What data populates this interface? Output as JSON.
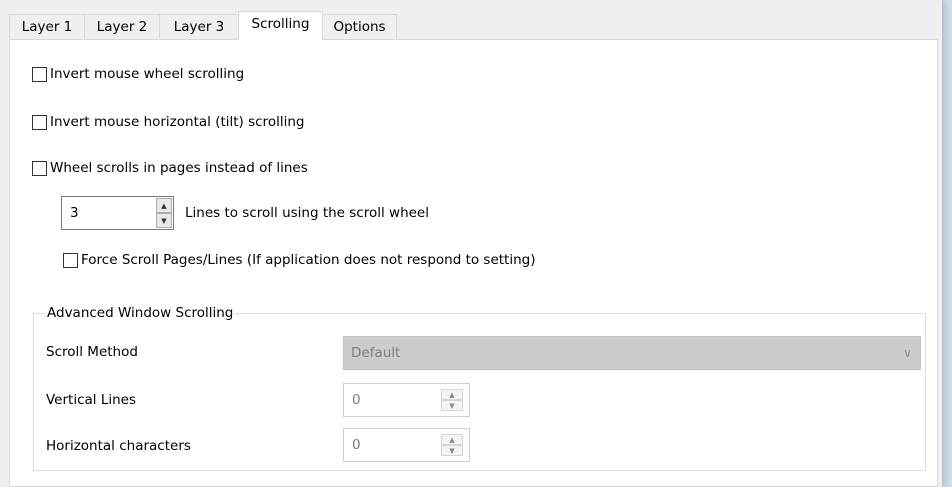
{
  "tabs": [
    "Layer 1",
    "Layer 2",
    "Layer 3",
    "Scrolling",
    "Options"
  ],
  "active_tab": "Scrolling",
  "checkboxes": {
    "invert_wheel": "Invert mouse wheel scrolling",
    "invert_horizontal": "Invert mouse horizontal (tilt) scrolling",
    "wheel_pages": "Wheel scrolls in pages instead of lines",
    "force_scroll": "Force Scroll Pages/Lines (If application does not respond to setting)"
  },
  "lines_to_scroll": {
    "value": "3",
    "label": "Lines to scroll using the scroll wheel"
  },
  "advanced": {
    "title": "Advanced Window Scrolling",
    "scroll_method_label": "Scroll Method",
    "scroll_method_value": "Default",
    "vertical_lines_label": "Vertical Lines",
    "vertical_lines_value": "0",
    "horizontal_chars_label": "Horizontal characters",
    "horizontal_chars_value": "0"
  },
  "icons": {
    "spinner_up": "▲",
    "spinner_down": "▼",
    "dropdown": "∨"
  }
}
